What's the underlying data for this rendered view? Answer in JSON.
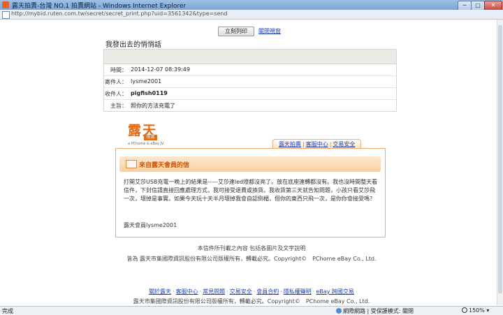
{
  "window": {
    "title": "露天拍賣-台灣 NO.1 拍賣網站 - Windows Internet Explorer",
    "url": "http://mybid.ruten.com.tw/secret/secret_print.php?uid=3561342&type=send"
  },
  "actions": {
    "print_label": "立刻列印",
    "close_label": "關閉視窗"
  },
  "page": {
    "heading": "我發出去的悄悄話"
  },
  "message": {
    "fields": [
      {
        "label": "時間：",
        "value": "2014-12-07 08:39:49"
      },
      {
        "label": "寄件人：",
        "value": "lysme2001"
      },
      {
        "label": "收件人：",
        "value": "pigfish0119"
      },
      {
        "label": "主旨：",
        "value": "照你的方法充電了"
      }
    ]
  },
  "logo": {
    "char1": "露",
    "char2": "天",
    "badge": "拍賣",
    "tagline": "a PChome & eBay JV"
  },
  "tabs": [
    "露天拍賣",
    "客服中心",
    "交易安全"
  ],
  "mail": {
    "header": "來自露天會員的信",
    "body": "打開艾莎USB充電一晚上的結果是-----艾莎連led燈都沒亮了。放在底座連轉都沒有。我也沒時間整天看信件，下封信請直接回應處理方式，我可接受退費或換貨。我收貨第三天就告知問題，小孩只看艾莎飛一次，壞掉是事實。如果今天玩十天半月壞掉我會自認倒楣，但你的東西只飛一次，是你你會接受嗎？",
    "signature": "露天會員lysme2001"
  },
  "notices": {
    "line1": "本信件所刊載之內容 包括各圖片及文字說明",
    "line2": "皆為 露天市集國際資訊股份有限公司版權所有，轉載必究。Copyright©　PChome eBay Co., Ltd."
  },
  "footer": {
    "links": [
      "關於露天",
      "客服中心",
      "常見問題",
      "交易安全",
      "會員合約",
      "隱私權聲明",
      "eBay 跨國交易"
    ],
    "copyright": "露天市集國際資訊股份有限公司版權所有，轉載必究。Copyright©　PChome eBay Co., Ltd."
  },
  "statusbar": {
    "status": "完成",
    "zone": "網際網路 | 受保護模式: 關閉",
    "zoom": "150%"
  }
}
